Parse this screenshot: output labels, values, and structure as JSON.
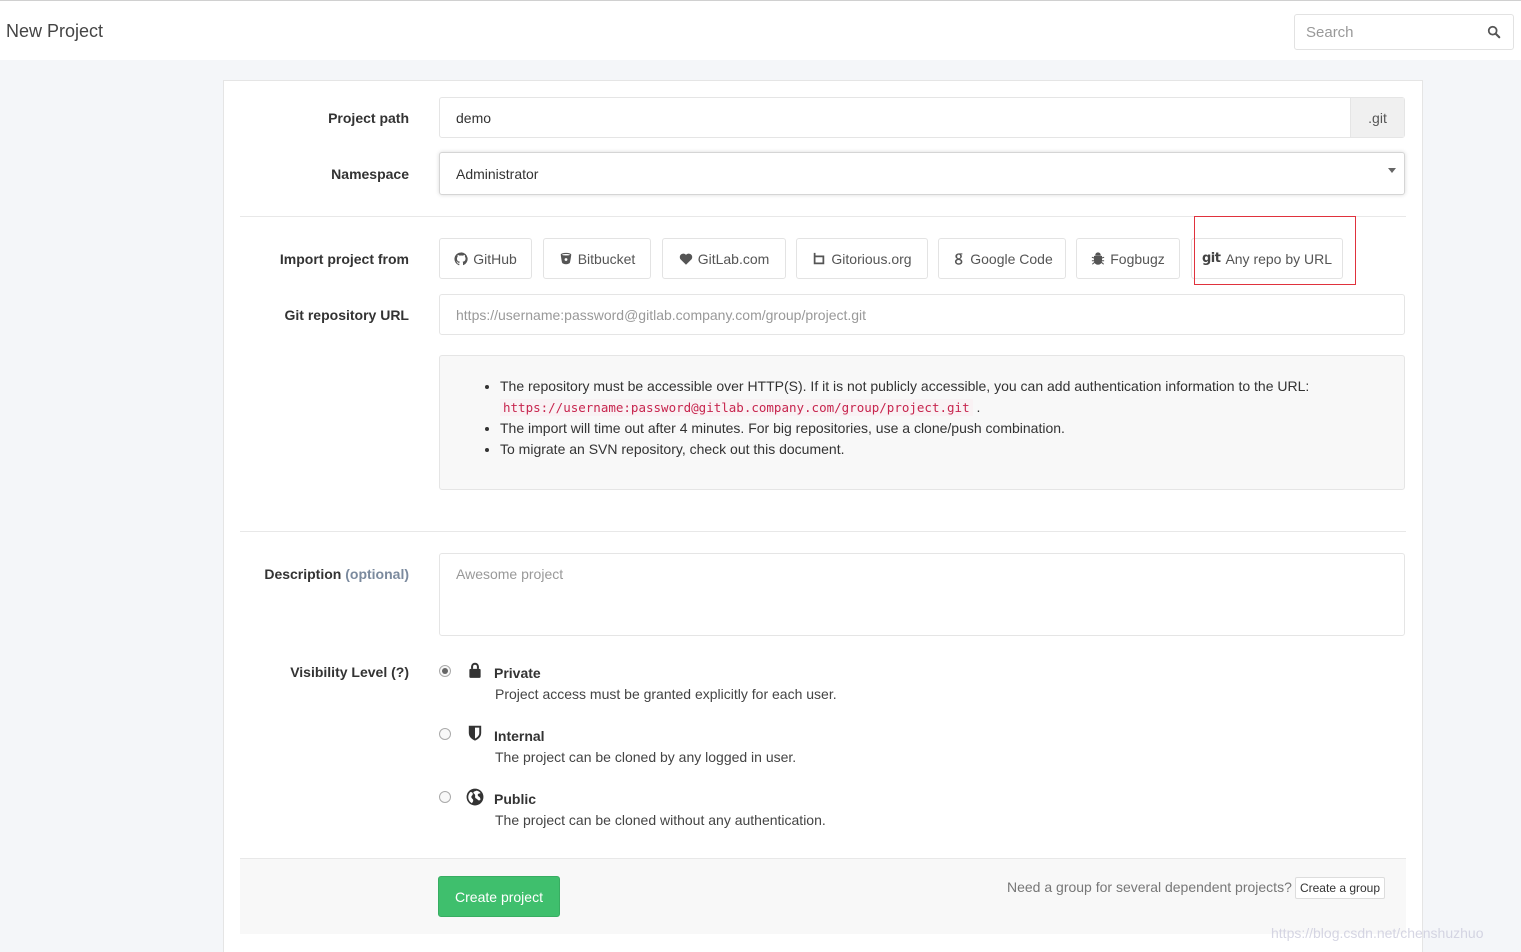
{
  "header": {
    "title": "New Project",
    "search_placeholder": "Search"
  },
  "form": {
    "project_path": {
      "label": "Project path",
      "value": "demo",
      "suffix": ".git"
    },
    "namespace": {
      "label": "Namespace",
      "selected": "Administrator"
    },
    "import": {
      "label": "Import project from",
      "buttons": [
        {
          "label": "GitHub",
          "icon": "github-icon"
        },
        {
          "label": "Bitbucket",
          "icon": "bitbucket-icon"
        },
        {
          "label": "GitLab.com",
          "icon": "heart-icon"
        },
        {
          "label": "Gitorious.org",
          "icon": "gitorious-icon"
        },
        {
          "label": "Google Code",
          "icon": "google-icon"
        },
        {
          "label": "Fogbugz",
          "icon": "bug-icon"
        },
        {
          "label": "Any repo by URL",
          "icon": "git-icon",
          "icon_text": "git",
          "highlighted": true
        }
      ]
    },
    "git_url": {
      "label": "Git repository URL",
      "placeholder": "https://username:password@gitlab.company.com/group/project.git"
    },
    "info": {
      "item1": "The repository must be accessible over HTTP(S). If it is not publicly accessible, you can add authentication information to the URL:",
      "item1_code": "https://username:password@gitlab.company.com/group/project.git",
      "item1_end": ".",
      "item2": "The import will time out after 4 minutes. For big repositories, use a clone/push combination.",
      "item3_prefix": "To migrate an SVN repository, check out ",
      "item3_link": "this document",
      "item3_end": "."
    },
    "description": {
      "label": "Description",
      "optional": "(optional)",
      "placeholder": "Awesome project"
    },
    "visibility": {
      "label": "Visibility Level",
      "help": "(?)",
      "options": [
        {
          "title": "Private",
          "desc": "Project access must be granted explicitly for each user.",
          "icon": "lock-icon",
          "checked": true
        },
        {
          "title": "Internal",
          "desc": "The project can be cloned by any logged in user.",
          "icon": "shield-icon",
          "checked": false
        },
        {
          "title": "Public",
          "desc": "The project can be cloned without any authentication.",
          "icon": "globe-icon",
          "checked": false
        }
      ]
    }
  },
  "footer": {
    "create_label": "Create project",
    "group_text": "Need a group for several dependent projects?",
    "group_button": "Create a group"
  },
  "watermark": "https://blog.csdn.net/chenshuzhuo",
  "colors": {
    "primary": "#3fbf6d",
    "highlight_border": "#e0323d",
    "code": "#c7254e"
  }
}
